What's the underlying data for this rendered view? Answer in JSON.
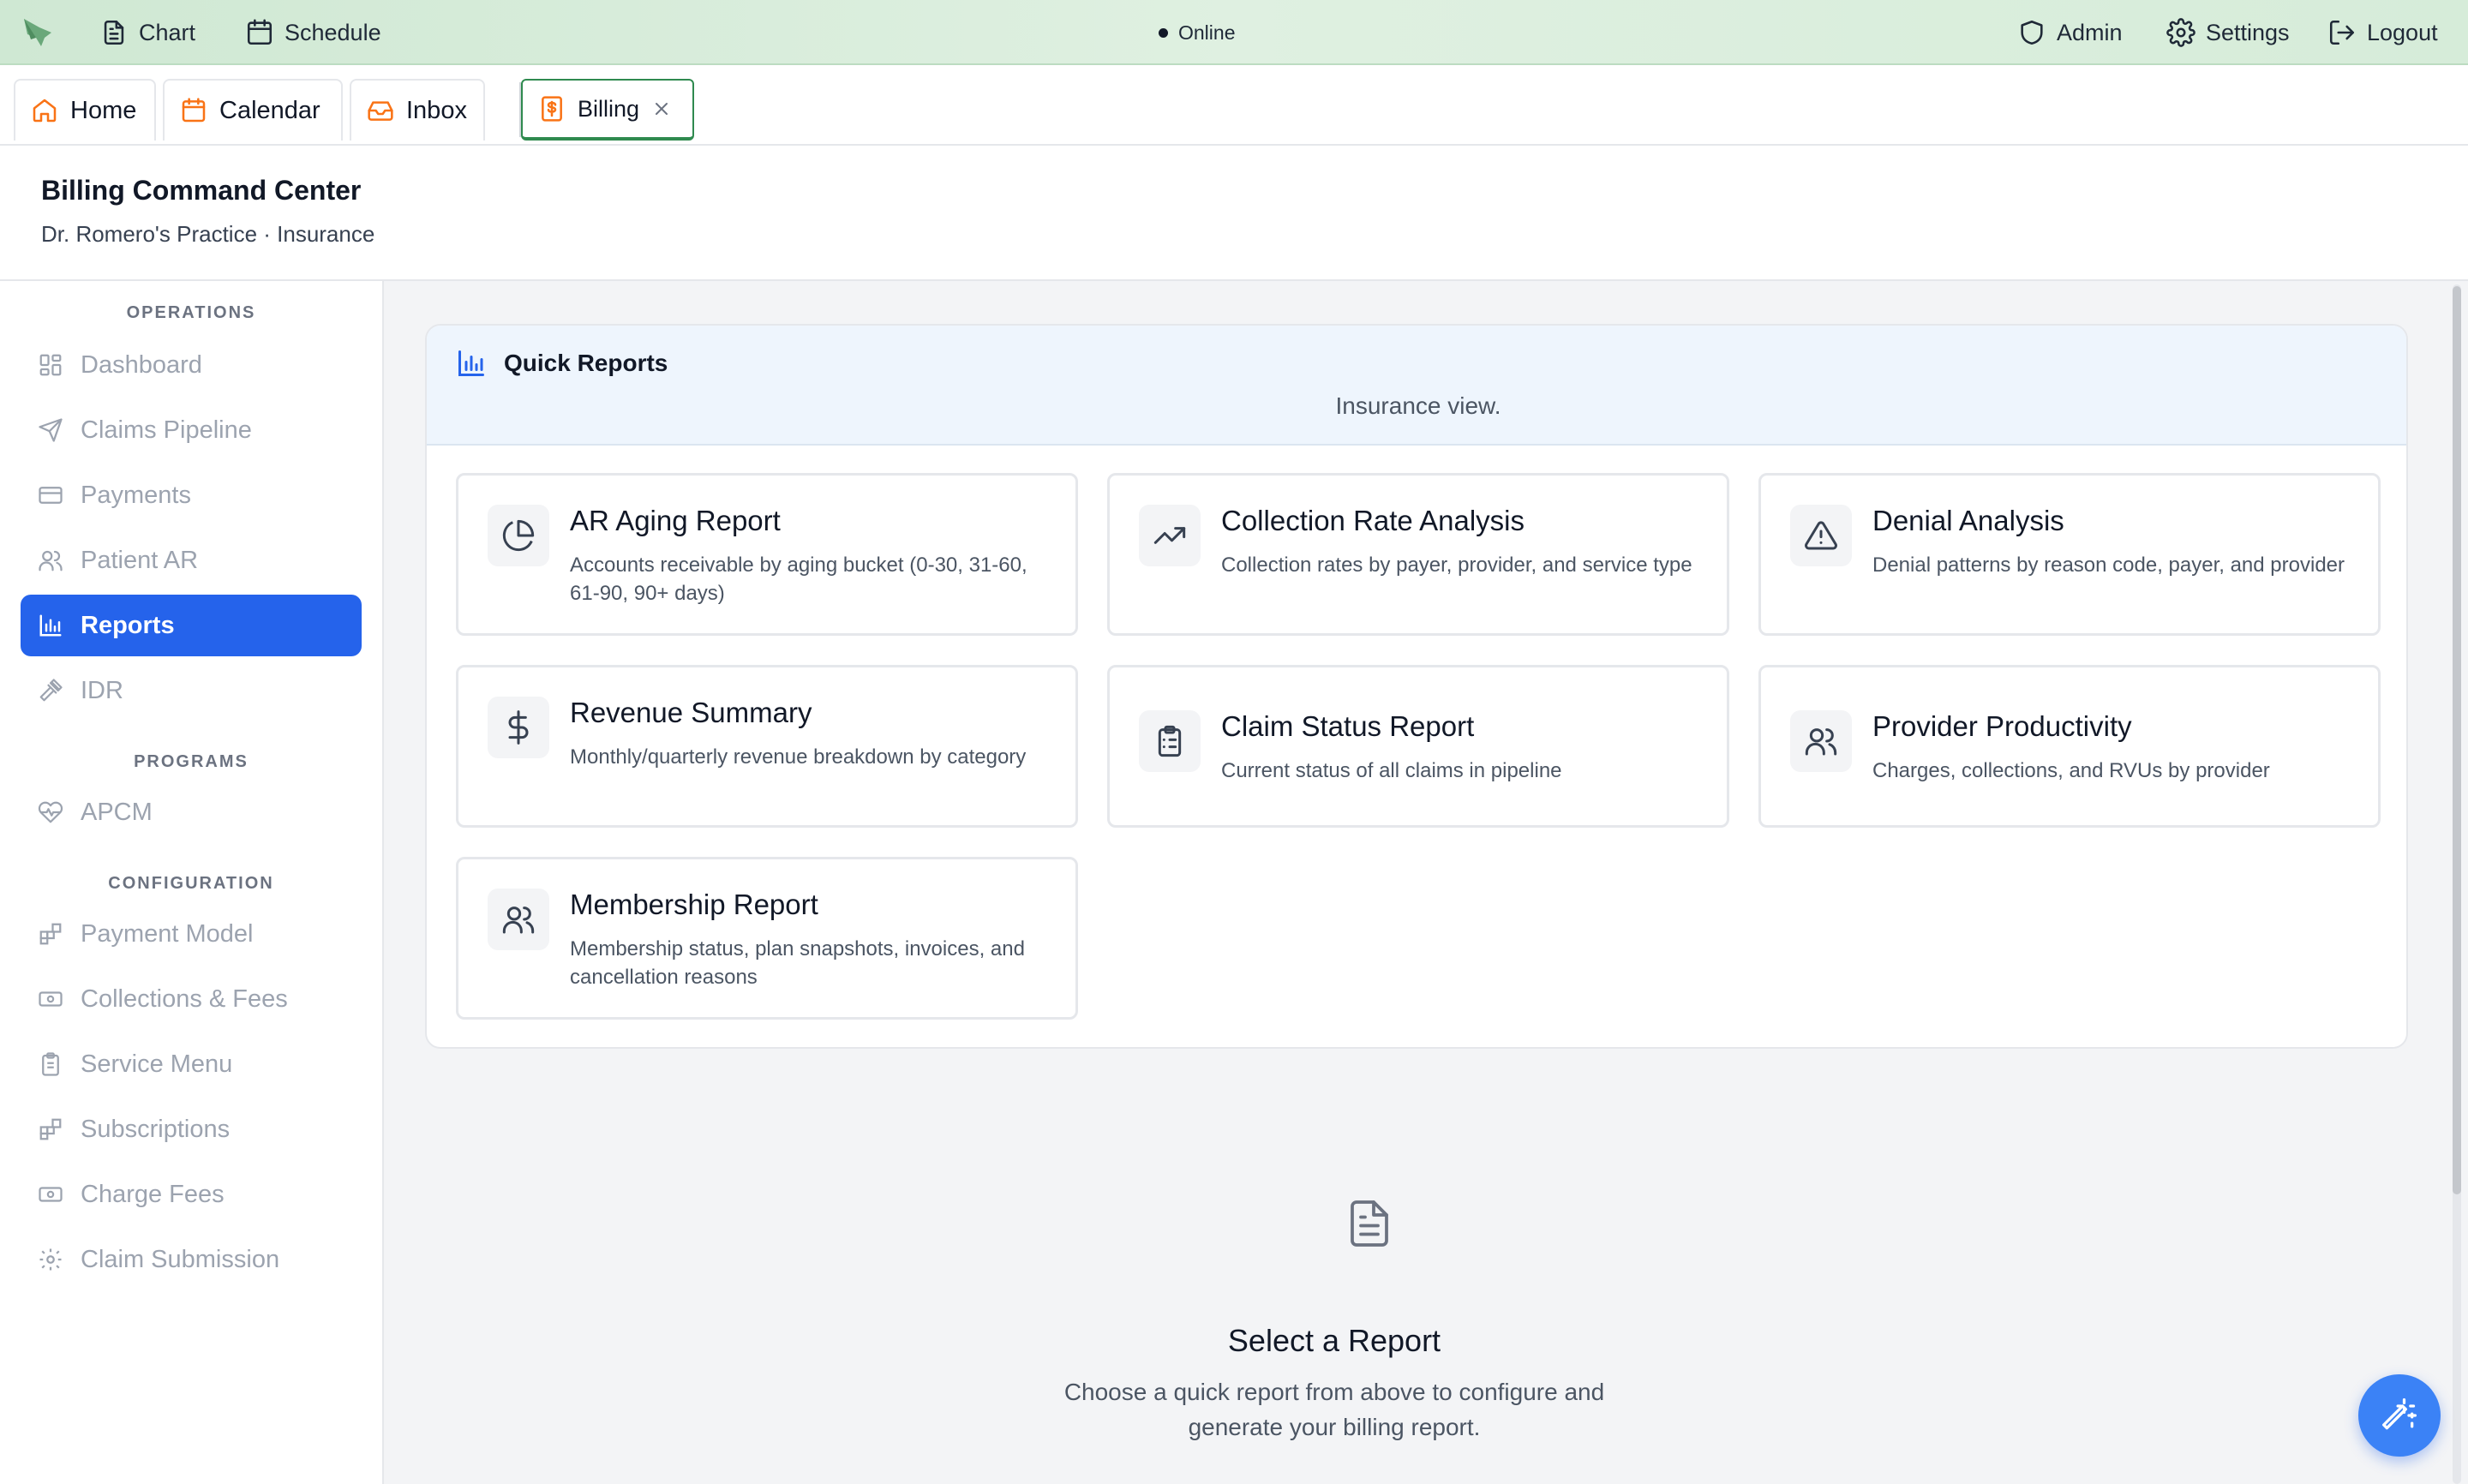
{
  "topbar": {
    "nav": [
      {
        "label": "Chart",
        "icon": "document-icon"
      },
      {
        "label": "Schedule",
        "icon": "calendar-icon"
      }
    ],
    "status": "Online",
    "right": [
      {
        "label": "Admin",
        "icon": "shield-icon"
      },
      {
        "label": "Settings",
        "icon": "gear-icon"
      },
      {
        "label": "Logout",
        "icon": "logout-icon"
      }
    ],
    "accent": "#2f8a4f"
  },
  "tabs": [
    {
      "label": "Home",
      "icon": "home-icon"
    },
    {
      "label": "Calendar",
      "icon": "calendar-icon"
    },
    {
      "label": "Inbox",
      "icon": "inbox-icon"
    },
    {
      "label": "Billing",
      "icon": "invoice-icon",
      "active": true
    }
  ],
  "header": {
    "title": "Billing Command Center",
    "subtitle": "Dr. Romero's Practice · Insurance"
  },
  "sidebar": {
    "sections": [
      {
        "label": "OPERATIONS",
        "items": [
          {
            "label": "Dashboard",
            "icon": "grid-icon"
          },
          {
            "label": "Claims Pipeline",
            "icon": "send-icon"
          },
          {
            "label": "Payments",
            "icon": "credit-card-icon"
          },
          {
            "label": "Patient AR",
            "icon": "users-icon"
          },
          {
            "label": "Reports",
            "icon": "bar-chart-icon",
            "active": true
          },
          {
            "label": "IDR",
            "icon": "gavel-icon"
          }
        ]
      },
      {
        "label": "PROGRAMS",
        "items": [
          {
            "label": "APCM",
            "icon": "heart-pulse-icon"
          }
        ]
      },
      {
        "label": "CONFIGURATION",
        "items": [
          {
            "label": "Payment Model",
            "icon": "blocks-icon"
          },
          {
            "label": "Collections & Fees",
            "icon": "banknote-icon"
          },
          {
            "label": "Service Menu",
            "icon": "clipboard-icon"
          },
          {
            "label": "Subscriptions",
            "icon": "blocks-icon"
          },
          {
            "label": "Charge Fees",
            "icon": "banknote-icon"
          },
          {
            "label": "Claim Submission",
            "icon": "gear-icon"
          }
        ]
      }
    ],
    "active_color": "#2563eb"
  },
  "quick_reports": {
    "title": "Quick Reports",
    "subtitle": "Insurance view.",
    "cards": [
      {
        "title": "AR Aging Report",
        "desc": "Accounts receivable by aging bucket (0-30, 31-60, 61-90, 90+ days)",
        "icon": "pie-chart-icon"
      },
      {
        "title": "Collection Rate Analysis",
        "desc": "Collection rates by payer, provider, and service type",
        "icon": "trending-up-icon"
      },
      {
        "title": "Denial Analysis",
        "desc": "Denial patterns by reason code, payer, and provider",
        "icon": "warning-icon"
      },
      {
        "title": "Revenue Summary",
        "desc": "Monthly/quarterly revenue breakdown by category",
        "icon": "dollar-icon"
      },
      {
        "title": "Claim Status Report",
        "desc": "Current status of all claims in pipeline",
        "icon": "clipboard-list-icon"
      },
      {
        "title": "Provider Productivity",
        "desc": "Charges, collections, and RVUs by provider",
        "icon": "users-icon"
      },
      {
        "title": "Membership Report",
        "desc": "Membership status, plan snapshots, invoices, and cancellation reasons",
        "icon": "users-icon"
      }
    ]
  },
  "empty_state": {
    "title": "Select a Report",
    "desc": "Choose a quick report from above to configure and generate your billing report.",
    "icon": "file-text-icon"
  },
  "fab": {
    "icon": "magic-wand-icon",
    "color": "#3b82f6"
  }
}
